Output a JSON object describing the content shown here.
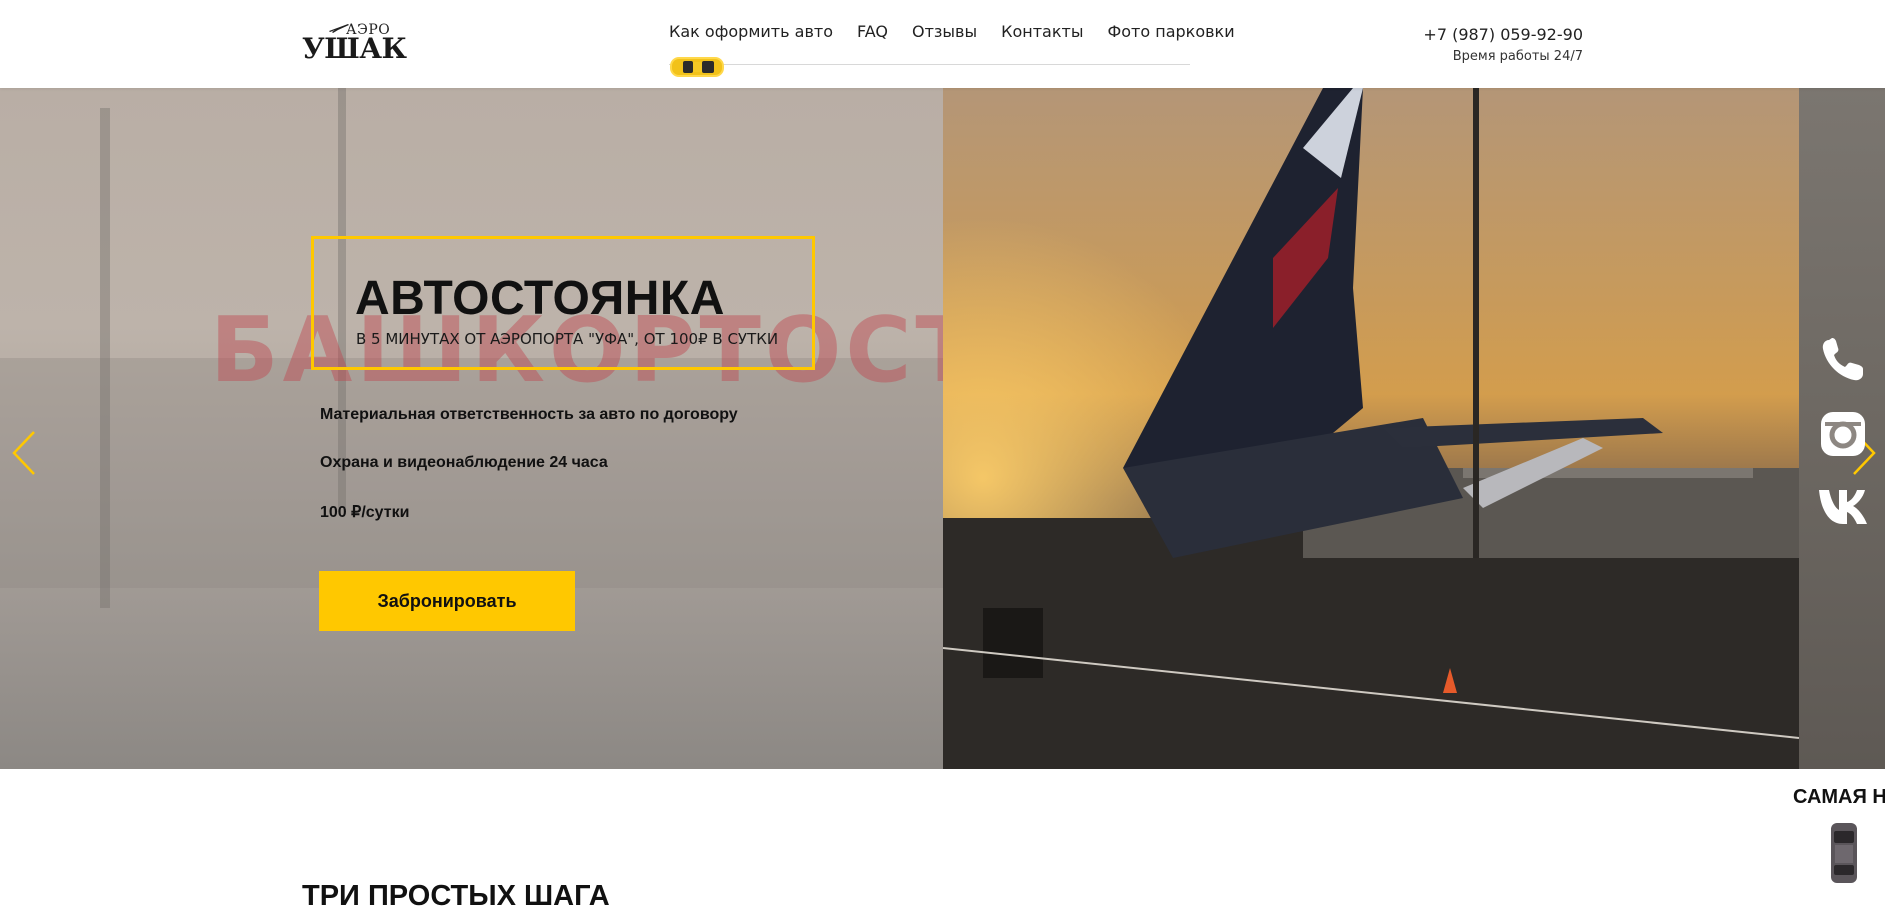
{
  "logo": {
    "top": "АЭРО",
    "main": "УШАК"
  },
  "nav": {
    "items": [
      "Как оформить авто",
      "FAQ",
      "Отзывы",
      "Контакты",
      "Фото парковки"
    ]
  },
  "contact": {
    "phone": "+7 (987) 059-92-90",
    "hours": "Время работы 24/7"
  },
  "hero": {
    "background_sign": "БАШКОРТОСТАН",
    "title": "АВТОСТОЯНКА",
    "subtitle": "В 5 МИНУТАХ ОТ АЭРОПОРТА \"УФА\", ОТ 100₽ В СУТКИ",
    "features": [
      "Материальная ответственность за авто по договору",
      "Охрана и видеонаблюдение 24 часа",
      "100 ₽/сутки"
    ],
    "cta_label": "Забронировать"
  },
  "promo": {
    "text": "САМАЯ Н"
  },
  "section": {
    "title": "ТРИ ПРОСТЫХ ШАГА"
  },
  "colors": {
    "accent": "#ffc800",
    "text": "#111111",
    "white": "#ffffff"
  },
  "icons": {
    "prev": "chevron-left-icon",
    "next": "chevron-right-icon",
    "social": [
      "phone-icon",
      "instagram-icon",
      "vk-icon"
    ]
  }
}
